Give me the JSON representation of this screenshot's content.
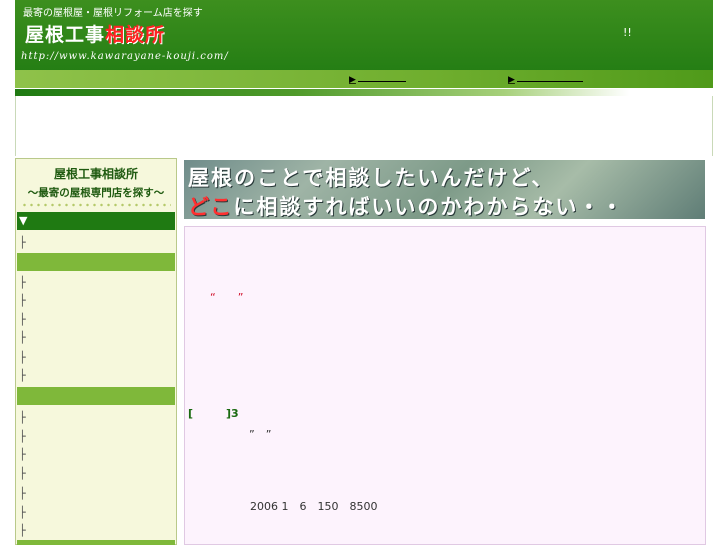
{
  "header": {
    "tagline": "最寄の屋根屋・屋根リフォーム店を探す",
    "logo_main": "屋根工事",
    "logo_accent": "相談所",
    "url": "http://www.kawarayane-kouji.com/",
    "exclaim": "!!"
  },
  "nav": {
    "links": [
      "",
      ""
    ]
  },
  "sidebar": {
    "title": "屋根工事相談所",
    "subtitle": "～最寄の屋根専門店を探す～",
    "section1_header": "▼",
    "tee": "├"
  },
  "banner": {
    "line1": "屋根のことで相談したいんだけど、",
    "line2_red": "どこ",
    "line2_rest": "に相談すればいいのかわからない・・"
  },
  "content": {
    "quote": "“　　”",
    "bracket": "[　　　]3",
    "quote2": "”　”",
    "dateline": "2006 1　6　150　8500"
  },
  "colors": {
    "header_green": "#1f7a12",
    "nav_green": "#7fb83a",
    "sidebar_bg": "#f6f8dc",
    "content_bg": "#fdf3fd",
    "accent_red": "#ff2222"
  }
}
